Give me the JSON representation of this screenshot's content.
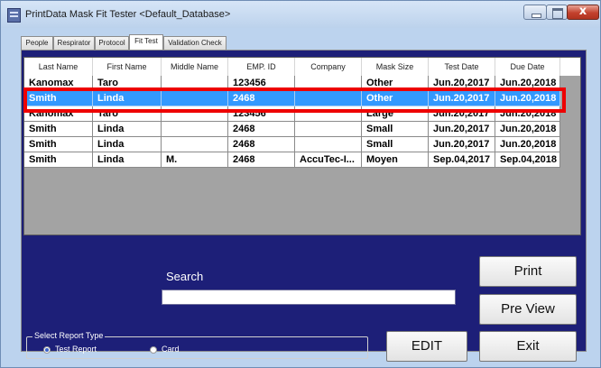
{
  "window": {
    "title": "PrintData Mask Fit Tester <Default_Database>"
  },
  "tabs": [
    {
      "label": "People",
      "active": false
    },
    {
      "label": "Respirator",
      "active": false
    },
    {
      "label": "Protocol",
      "active": false
    },
    {
      "label": "Fit Test",
      "active": true
    },
    {
      "label": "Validation Check",
      "active": false
    }
  ],
  "table": {
    "columns": [
      "Last Name",
      "First Name",
      "Middle Name",
      "EMP. ID",
      "Company",
      "Mask Size",
      "Test Date",
      "Due Date"
    ],
    "rows": [
      [
        "Kanomax",
        "Taro",
        "",
        "123456",
        "",
        "Other",
        "Jun.20,2017",
        "Jun.20,2018"
      ],
      [
        "Smith",
        "Linda",
        "",
        "2468",
        "",
        "Other",
        "Jun.20,2017",
        "Jun.20,2018"
      ],
      [
        "Kanomax",
        "Taro",
        "",
        "123456",
        "",
        "Large",
        "Jun.20,2017",
        "Jun.20,2018"
      ],
      [
        "Smith",
        "Linda",
        "",
        "2468",
        "",
        "Small",
        "Jun.20,2017",
        "Jun.20,2018"
      ],
      [
        "Smith",
        "Linda",
        "",
        "2468",
        "",
        "Small",
        "Jun.20,2017",
        "Jun.20,2018"
      ],
      [
        "Smith",
        "Linda",
        "M.",
        "2468",
        "AccuTec-I...",
        "Moyen",
        "Sep.04,2017",
        "Sep.04,2018"
      ]
    ],
    "selected_row": 2
  },
  "search": {
    "label": "Search",
    "value": ""
  },
  "buttons": {
    "print": "Print",
    "preview": "Pre View",
    "edit": "EDIT",
    "exit": "Exit"
  },
  "report_type": {
    "legend": "Select Report Type",
    "options": [
      {
        "label": "Test Report",
        "checked": true
      },
      {
        "label": "Card",
        "checked": false
      }
    ]
  },
  "colors": {
    "panel": "#1d1f78",
    "selection": "#3399ff",
    "highlight": "#ee0000"
  }
}
